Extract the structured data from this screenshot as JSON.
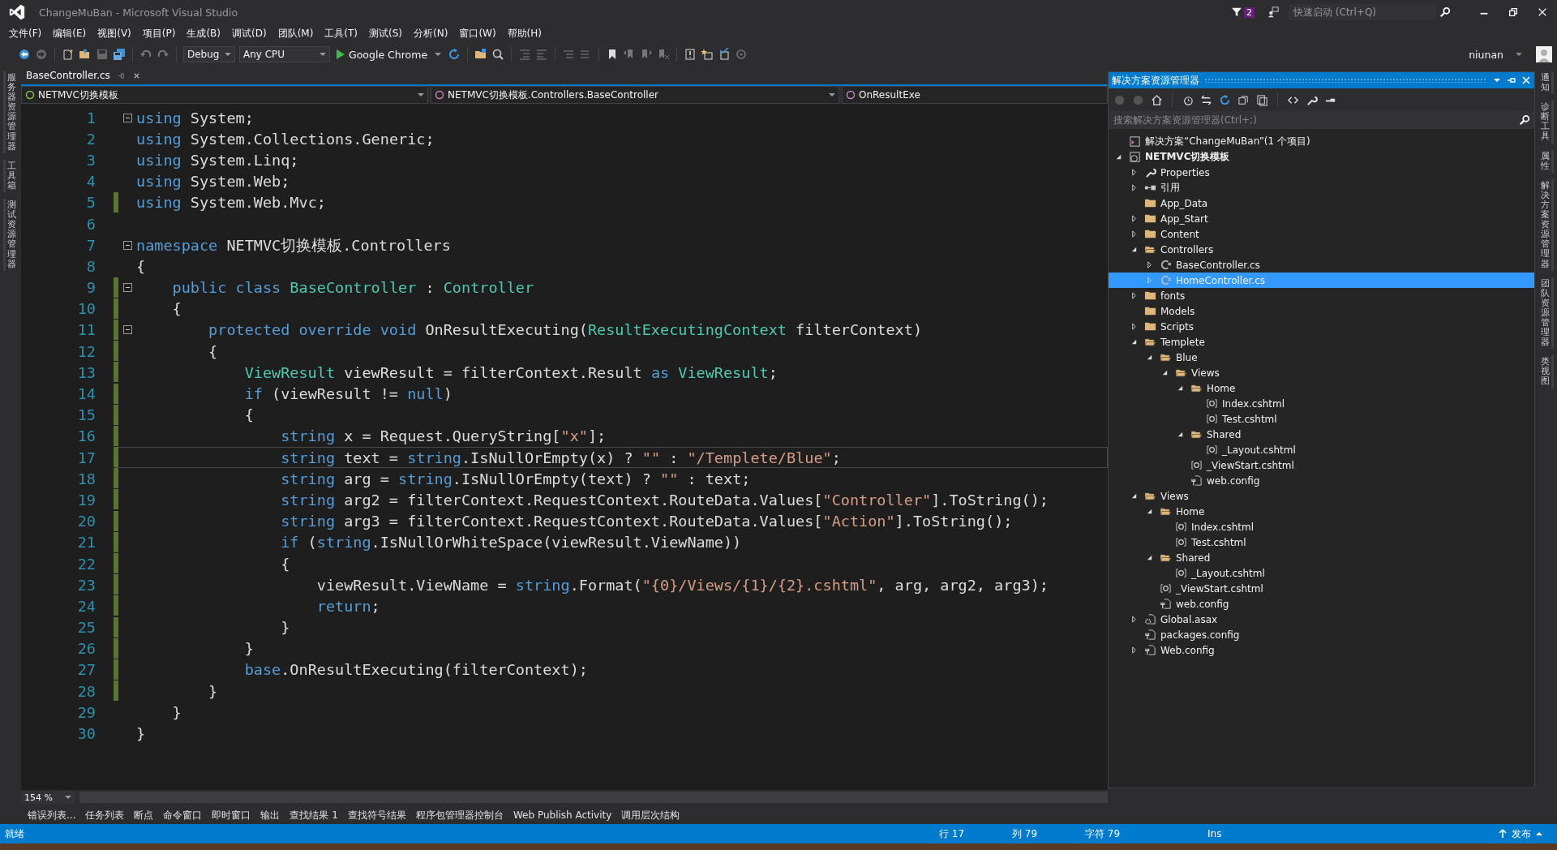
{
  "window": {
    "title": "ChangeMuBan - Microsoft Visual Studio",
    "notification_count": "2",
    "quick_launch": {
      "placeholder": "快速启动 (Ctrl+Q)"
    },
    "user": "niunan"
  },
  "menu": [
    "文件(F)",
    "编辑(E)",
    "视图(V)",
    "项目(P)",
    "生成(B)",
    "调试(D)",
    "团队(M)",
    "工具(T)",
    "测试(S)",
    "分析(N)",
    "窗口(W)",
    "帮助(H)"
  ],
  "toolbar": {
    "configuration": "Debug",
    "platform": "Any CPU",
    "run_target": "Google Chrome"
  },
  "left_tool_tabs": [
    "服务器资源管理器",
    "工具箱",
    "测试资源管理器"
  ],
  "right_tool_tabs": [
    "通知",
    "诊断工具",
    "属性",
    "解决方案资源管理器",
    "团队资源管理器",
    "类视图"
  ],
  "editor": {
    "tabs": [
      {
        "label": "BaseController.cs",
        "selected": true
      }
    ],
    "nav_bar": [
      "NETMVC切换模板",
      "NETMVC切换模板.Controllers.BaseController",
      "OnResultExe"
    ],
    "zoom": "154 %"
  },
  "code": {
    "lines": [
      {
        "number": "1",
        "foldable": true,
        "changed": false,
        "current": false,
        "tokens": [
          {
            "kind": "keyword",
            "text": "using"
          },
          {
            "kind": "plain",
            "text": " System;"
          }
        ]
      },
      {
        "number": "2",
        "foldable": false,
        "changed": false,
        "current": false,
        "tokens": [
          {
            "kind": "keyword",
            "text": "using"
          },
          {
            "kind": "plain",
            "text": " System.Collections.Generic;"
          }
        ]
      },
      {
        "number": "3",
        "foldable": false,
        "changed": false,
        "current": false,
        "tokens": [
          {
            "kind": "keyword",
            "text": "using"
          },
          {
            "kind": "plain",
            "text": " System.Linq;"
          }
        ]
      },
      {
        "number": "4",
        "foldable": false,
        "changed": false,
        "current": false,
        "tokens": [
          {
            "kind": "keyword",
            "text": "using"
          },
          {
            "kind": "plain",
            "text": " System.Web;"
          }
        ]
      },
      {
        "number": "5",
        "foldable": false,
        "changed": true,
        "current": false,
        "tokens": [
          {
            "kind": "keyword",
            "text": "using"
          },
          {
            "kind": "plain",
            "text": " System.Web.Mvc;"
          }
        ]
      },
      {
        "number": "6",
        "foldable": false,
        "changed": false,
        "current": false
      },
      {
        "number": "7",
        "foldable": true,
        "changed": false,
        "current": false,
        "tokens": [
          {
            "kind": "keyword",
            "text": "namespace"
          },
          {
            "kind": "plain",
            "text": " NETMVC切换模板.Controllers"
          }
        ]
      },
      {
        "number": "8",
        "foldable": false,
        "changed": false,
        "current": false,
        "tokens": [
          {
            "kind": "plain",
            "text": "{"
          }
        ]
      },
      {
        "number": "9",
        "foldable": true,
        "changed": true,
        "current": false,
        "tokens": [
          {
            "kind": "keyword",
            "text": "    public class "
          },
          {
            "kind": "type",
            "text": "BaseController"
          },
          {
            "kind": "plain",
            "text": " : "
          },
          {
            "kind": "type",
            "text": "Controller"
          }
        ]
      },
      {
        "number": "10",
        "foldable": false,
        "changed": true,
        "current": false,
        "tokens": [
          {
            "kind": "plain",
            "text": "    {"
          }
        ]
      },
      {
        "number": "11",
        "foldable": true,
        "changed": true,
        "current": false,
        "tokens": [
          {
            "kind": "keyword",
            "text": "        protected override void"
          },
          {
            "kind": "plain",
            "text": " OnResultExecuting("
          },
          {
            "kind": "type",
            "text": "ResultExecutingContext"
          },
          {
            "kind": "plain",
            "text": " filterContext)"
          }
        ]
      },
      {
        "number": "12",
        "foldable": false,
        "changed": true,
        "current": false,
        "tokens": [
          {
            "kind": "plain",
            "text": "        {"
          }
        ]
      },
      {
        "number": "13",
        "foldable": false,
        "changed": true,
        "current": false,
        "tokens": [
          {
            "kind": "type",
            "text": "            ViewResult"
          },
          {
            "kind": "plain",
            "text": " viewResult = filterContext.Result "
          },
          {
            "kind": "keyword",
            "text": "as "
          },
          {
            "kind": "type",
            "text": "ViewResult"
          },
          {
            "kind": "plain",
            "text": ";"
          }
        ]
      },
      {
        "number": "14",
        "foldable": false,
        "changed": true,
        "current": false,
        "tokens": [
          {
            "kind": "keyword",
            "text": "            if"
          },
          {
            "kind": "plain",
            "text": " (viewResult != "
          },
          {
            "kind": "keyword",
            "text": "null"
          },
          {
            "kind": "plain",
            "text": ")"
          }
        ]
      },
      {
        "number": "15",
        "foldable": false,
        "changed": true,
        "current": false,
        "tokens": [
          {
            "kind": "plain",
            "text": "            {"
          }
        ]
      },
      {
        "number": "16",
        "foldable": false,
        "changed": true,
        "current": false,
        "tokens": [
          {
            "kind": "keyword",
            "text": "                string"
          },
          {
            "kind": "plain",
            "text": " x = Request.QueryString["
          },
          {
            "kind": "string",
            "text": "\"x\""
          },
          {
            "kind": "plain",
            "text": "];"
          }
        ]
      },
      {
        "number": "17",
        "foldable": false,
        "changed": true,
        "current": true,
        "tokens": [
          {
            "kind": "keyword",
            "text": "                string"
          },
          {
            "kind": "plain",
            "text": " text = "
          },
          {
            "kind": "keyword",
            "text": "string"
          },
          {
            "kind": "plain",
            "text": ".IsNullOrEmpty(x) ? "
          },
          {
            "kind": "string",
            "text": "\"\""
          },
          {
            "kind": "plain",
            "text": " : "
          },
          {
            "kind": "string",
            "text": "\"/Templete/Blue\""
          },
          {
            "kind": "plain",
            "text": ";"
          }
        ]
      },
      {
        "number": "18",
        "foldable": false,
        "changed": true,
        "current": false,
        "tokens": [
          {
            "kind": "keyword",
            "text": "                string"
          },
          {
            "kind": "plain",
            "text": " arg = "
          },
          {
            "kind": "keyword",
            "text": "string"
          },
          {
            "kind": "plain",
            "text": ".IsNullOrEmpty(text) ? "
          },
          {
            "kind": "string",
            "text": "\"\""
          },
          {
            "kind": "plain",
            "text": " : text;"
          }
        ]
      },
      {
        "number": "19",
        "foldable": false,
        "changed": true,
        "current": false,
        "tokens": [
          {
            "kind": "keyword",
            "text": "                string"
          },
          {
            "kind": "plain",
            "text": " arg2 = filterContext.RequestContext.RouteData.Values["
          },
          {
            "kind": "string",
            "text": "\"Controller\""
          },
          {
            "kind": "plain",
            "text": "].ToString();"
          }
        ]
      },
      {
        "number": "20",
        "foldable": false,
        "changed": true,
        "current": false,
        "tokens": [
          {
            "kind": "keyword",
            "text": "                string"
          },
          {
            "kind": "plain",
            "text": " arg3 = filterContext.RequestContext.RouteData.Values["
          },
          {
            "kind": "string",
            "text": "\"Action\""
          },
          {
            "kind": "plain",
            "text": "].ToString();"
          }
        ]
      },
      {
        "number": "21",
        "foldable": false,
        "changed": true,
        "current": false,
        "tokens": [
          {
            "kind": "keyword",
            "text": "                if"
          },
          {
            "kind": "plain",
            "text": " ("
          },
          {
            "kind": "keyword",
            "text": "string"
          },
          {
            "kind": "plain",
            "text": ".IsNullOrWhiteSpace(viewResult.ViewName))"
          }
        ]
      },
      {
        "number": "22",
        "foldable": false,
        "changed": true,
        "current": false,
        "tokens": [
          {
            "kind": "plain",
            "text": "                {"
          }
        ]
      },
      {
        "number": "23",
        "foldable": false,
        "changed": true,
        "current": false,
        "tokens": [
          {
            "kind": "plain",
            "text": "                    viewResult.ViewName = "
          },
          {
            "kind": "keyword",
            "text": "string"
          },
          {
            "kind": "plain",
            "text": ".Format("
          },
          {
            "kind": "string",
            "text": "\"{0}/Views/{1}/{2}.cshtml\""
          },
          {
            "kind": "plain",
            "text": ", arg, arg2, arg3);"
          }
        ]
      },
      {
        "number": "24",
        "foldable": false,
        "changed": true,
        "current": false,
        "tokens": [
          {
            "kind": "keyword",
            "text": "                    return"
          },
          {
            "kind": "plain",
            "text": ";"
          }
        ]
      },
      {
        "number": "25",
        "foldable": false,
        "changed": true,
        "current": false,
        "tokens": [
          {
            "kind": "plain",
            "text": "                }"
          }
        ]
      },
      {
        "number": "26",
        "foldable": false,
        "changed": true,
        "current": false,
        "tokens": [
          {
            "kind": "plain",
            "text": "            }"
          }
        ]
      },
      {
        "number": "27",
        "foldable": false,
        "changed": true,
        "current": false,
        "tokens": [
          {
            "kind": "keyword",
            "text": "            base"
          },
          {
            "kind": "plain",
            "text": ".OnResultExecuting(filterContext);"
          }
        ]
      },
      {
        "number": "28",
        "foldable": false,
        "changed": true,
        "current": false,
        "tokens": [
          {
            "kind": "plain",
            "text": "        }"
          }
        ]
      },
      {
        "number": "29",
        "foldable": false,
        "changed": false,
        "current": false,
        "tokens": [
          {
            "kind": "plain",
            "text": "    }"
          }
        ]
      },
      {
        "number": "30",
        "foldable": false,
        "changed": false,
        "current": false,
        "tokens": [
          {
            "kind": "plain",
            "text": "}"
          }
        ]
      }
    ]
  },
  "solution_explorer": {
    "title": "解决方案资源管理器",
    "search": {
      "placeholder": "搜索解决方案资源管理器(Ctrl+;)"
    },
    "tree": [
      {
        "kind": "solution",
        "label": "解决方案“ChangeMuBan”(1 个项目)",
        "selected": false
      },
      {
        "kind": "project",
        "label": "NETMVC切换模板",
        "selected": false,
        "expanded": true,
        "children": [
          {
            "kind": "properties",
            "label": "Properties",
            "selected": false,
            "expanded": false
          },
          {
            "kind": "references",
            "label": "引用",
            "selected": false,
            "expanded": false
          },
          {
            "kind": "folder",
            "label": "App_Data",
            "selected": false
          },
          {
            "kind": "folder",
            "label": "App_Start",
            "selected": false,
            "expanded": false
          },
          {
            "kind": "folder",
            "label": "Content",
            "selected": false,
            "expanded": false
          },
          {
            "kind": "folder",
            "label": "Controllers",
            "selected": false,
            "expanded": true,
            "children": [
              {
                "kind": "csharp",
                "label": "BaseController.cs",
                "selected": false,
                "expanded": false
              },
              {
                "kind": "csharp",
                "label": "HomeController.cs",
                "selected": true,
                "expanded": false
              }
            ]
          },
          {
            "kind": "folder",
            "label": "fonts",
            "selected": false,
            "expanded": false
          },
          {
            "kind": "folder",
            "label": "Models",
            "selected": false
          },
          {
            "kind": "folder",
            "label": "Scripts",
            "selected": false,
            "expanded": false
          },
          {
            "kind": "folder",
            "label": "Templete",
            "selected": false,
            "expanded": true,
            "children": [
              {
                "kind": "folder",
                "label": "Blue",
                "selected": false,
                "expanded": true,
                "children": [
                  {
                    "kind": "folder",
                    "label": "Views",
                    "selected": false,
                    "expanded": true,
                    "children": [
                      {
                        "kind": "folder",
                        "label": "Home",
                        "selected": false,
                        "expanded": true,
                        "children": [
                          {
                            "kind": "razor",
                            "label": "Index.cshtml",
                            "selected": false
                          },
                          {
                            "kind": "razor",
                            "label": "Test.cshtml",
                            "selected": false
                          }
                        ]
                      },
                      {
                        "kind": "folder",
                        "label": "Shared",
                        "selected": false,
                        "expanded": true,
                        "children": [
                          {
                            "kind": "razor",
                            "label": "_Layout.cshtml",
                            "selected": false
                          }
                        ]
                      },
                      {
                        "kind": "razor",
                        "label": "_ViewStart.cshtml",
                        "selected": false
                      },
                      {
                        "kind": "config",
                        "label": "web.config",
                        "selected": false
                      }
                    ]
                  }
                ]
              }
            ]
          },
          {
            "kind": "folder",
            "label": "Views",
            "selected": false,
            "expanded": true,
            "children": [
              {
                "kind": "folder",
                "label": "Home",
                "selected": false,
                "expanded": true,
                "children": [
                  {
                    "kind": "razor",
                    "label": "Index.cshtml",
                    "selected": false
                  },
                  {
                    "kind": "razor",
                    "label": "Test.cshtml",
                    "selected": false
                  }
                ]
              },
              {
                "kind": "folder",
                "label": "Shared",
                "selected": false,
                "expanded": true,
                "children": [
                  {
                    "kind": "razor",
                    "label": "_Layout.cshtml",
                    "selected": false
                  }
                ]
              },
              {
                "kind": "razor",
                "label": "_ViewStart.cshtml",
                "selected": false
              },
              {
                "kind": "config",
                "label": "web.config",
                "selected": false
              }
            ]
          },
          {
            "kind": "asax",
            "label": "Global.asax",
            "selected": false,
            "expanded": false
          },
          {
            "kind": "config",
            "label": "packages.config",
            "selected": false
          },
          {
            "kind": "config",
            "label": "Web.config",
            "selected": false,
            "expanded": false
          }
        ]
      }
    ]
  },
  "bottom_tool_tabs": [
    "错误列表...",
    "任务列表",
    "断点",
    "命令窗口",
    "即时窗口",
    "输出",
    "查找结果 1",
    "查找符号结果",
    "程序包管理器控制台",
    "Web Publish Activity",
    "调用层次结构"
  ],
  "status_bar": {
    "message": "就绪",
    "line": "行 17",
    "column": "列 79",
    "char": "字符 79",
    "mode": "Ins",
    "publish": "发布"
  }
}
